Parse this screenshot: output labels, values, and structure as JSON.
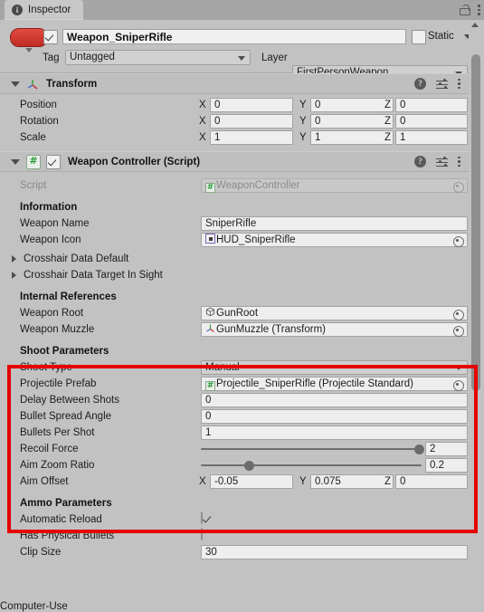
{
  "window": {
    "tab_label": "Inspector",
    "tab_icon": "info-icon",
    "lock_icon": "lock-icon",
    "menu_icon": "kebab-menu-icon"
  },
  "object_header": {
    "prefab_icon": "prefab-capsule-icon",
    "active_checked": true,
    "name": "Weapon_SniperRifle",
    "static_label": "Static",
    "static_checked": false,
    "tag_label": "Tag",
    "tag_value": "Untagged",
    "layer_label": "Layer",
    "layer_value": "FirstPersonWeapon"
  },
  "transform": {
    "title": "Transform",
    "icon": "transform-axis-icon",
    "rows": [
      {
        "label": "Position",
        "x": "0",
        "y": "0",
        "z": "0"
      },
      {
        "label": "Rotation",
        "x": "0",
        "y": "0",
        "z": "0"
      },
      {
        "label": "Scale",
        "x": "1",
        "y": "1",
        "z": "1"
      }
    ],
    "axis_labels": [
      "X",
      "Y",
      "Z"
    ]
  },
  "weapon_controller": {
    "title": "Weapon Controller (Script)",
    "icon": "csharp-script-icon",
    "enabled": true,
    "script_row": {
      "label": "Script",
      "value": "WeaponController"
    },
    "information": {
      "header": "Information",
      "weapon_name_label": "Weapon Name",
      "weapon_name_value": "SniperRifle",
      "weapon_icon_label": "Weapon Icon",
      "weapon_icon_value": "HUD_SniperRifle"
    },
    "foldouts": [
      {
        "label": "Crosshair Data Default"
      },
      {
        "label": "Crosshair Data Target In Sight"
      }
    ],
    "internal_references": {
      "header": "Internal References",
      "weapon_root_label": "Weapon Root",
      "weapon_root_value": "GunRoot",
      "weapon_muzzle_label": "Weapon Muzzle",
      "weapon_muzzle_value": "GunMuzzle (Transform)"
    },
    "shoot_parameters": {
      "header": "Shoot Parameters",
      "shoot_type_label": "Shoot Type",
      "shoot_type_value": "Manual",
      "projectile_prefab_label": "Projectile Prefab",
      "projectile_prefab_value": "Projectile_SniperRifle (Projectile Standard)",
      "delay_between_shots_label": "Delay Between Shots",
      "delay_between_shots_value": "0",
      "bullet_spread_angle_label": "Bullet Spread Angle",
      "bullet_spread_angle_value": "0",
      "bullets_per_shot_label": "Bullets Per Shot",
      "bullets_per_shot_value": "1",
      "recoil_force_label": "Recoil Force",
      "recoil_force_value": "2",
      "recoil_force_fill": 99,
      "aim_zoom_ratio_label": "Aim Zoom Ratio",
      "aim_zoom_ratio_value": "0.2",
      "aim_zoom_ratio_fill": 22,
      "aim_offset_label": "Aim Offset",
      "aim_offset_x": "-0.05",
      "aim_offset_y": "0.075",
      "aim_offset_z": "0",
      "highlight_color": "#e60000"
    },
    "ammo_parameters": {
      "header": "Ammo Parameters",
      "automatic_reload_label": "Automatic Reload",
      "automatic_reload_checked": true,
      "has_physical_bullets_label": "Has Physical Bullets",
      "has_physical_bullets_checked": false,
      "clip_size_label": "Clip Size",
      "clip_size_value": "30"
    }
  }
}
